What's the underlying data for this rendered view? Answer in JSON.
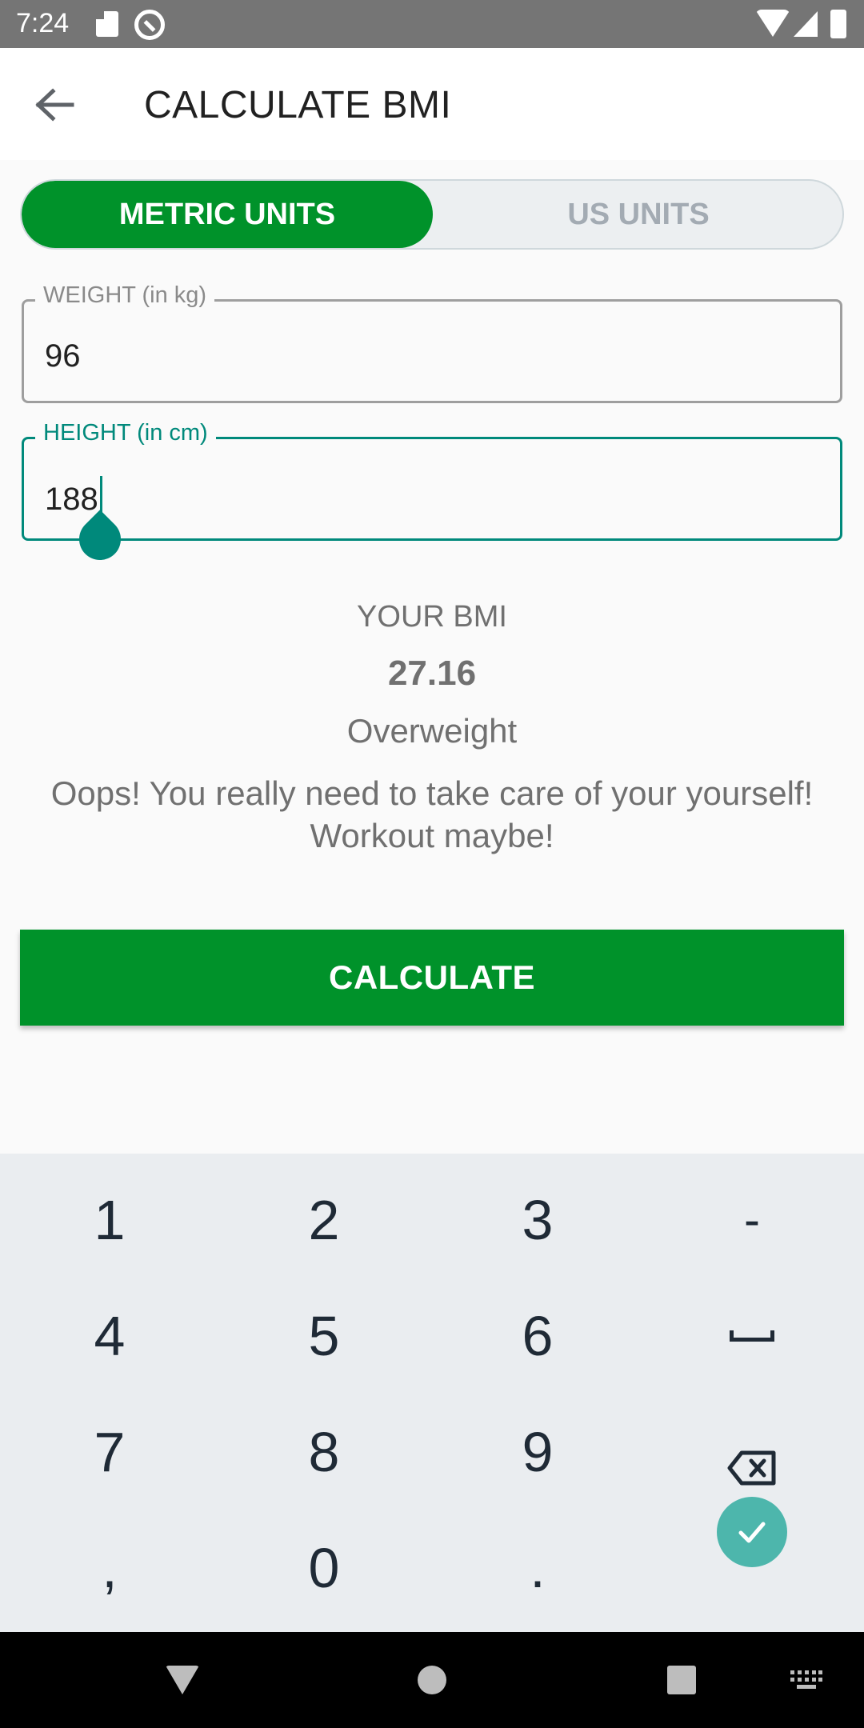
{
  "status_bar": {
    "time": "7:24",
    "icons": [
      "sd-card-icon",
      "do-not-disturb-icon",
      "wifi-icon",
      "signal-icon",
      "battery-icon"
    ]
  },
  "app_bar": {
    "back_icon": "arrow-left-icon",
    "title": "CALCULATE BMI"
  },
  "units_toggle": {
    "options": [
      "METRIC UNITS",
      "US UNITS"
    ],
    "selected": "METRIC UNITS",
    "active_color": "#00922a",
    "inactive_color": "#eceff1"
  },
  "form": {
    "weight": {
      "label": "WEIGHT (in kg)",
      "value": "96"
    },
    "height": {
      "label": "HEIGHT (in cm)",
      "value": "188",
      "focused": true,
      "focus_color": "#00897b"
    }
  },
  "result": {
    "heading": "YOUR BMI",
    "value": "27.16",
    "status": "Overweight",
    "message": "Oops! You really need to take care of your yourself! Workout maybe!"
  },
  "calculate_button": {
    "label": "CALCULATE",
    "color": "#00922a"
  },
  "keyboard": {
    "rows": [
      [
        "1",
        "2",
        "3",
        "-"
      ],
      [
        "4",
        "5",
        "6",
        "space-icon"
      ],
      [
        "7",
        "8",
        "9",
        "backspace-icon"
      ],
      [
        ",",
        "0",
        ".",
        "done-check-icon"
      ]
    ],
    "done_color": "#4db6ac"
  },
  "nav_bar": {
    "icons": [
      "nav-back-icon",
      "nav-home-icon",
      "nav-recents-icon",
      "keyboard-switch-icon"
    ]
  }
}
